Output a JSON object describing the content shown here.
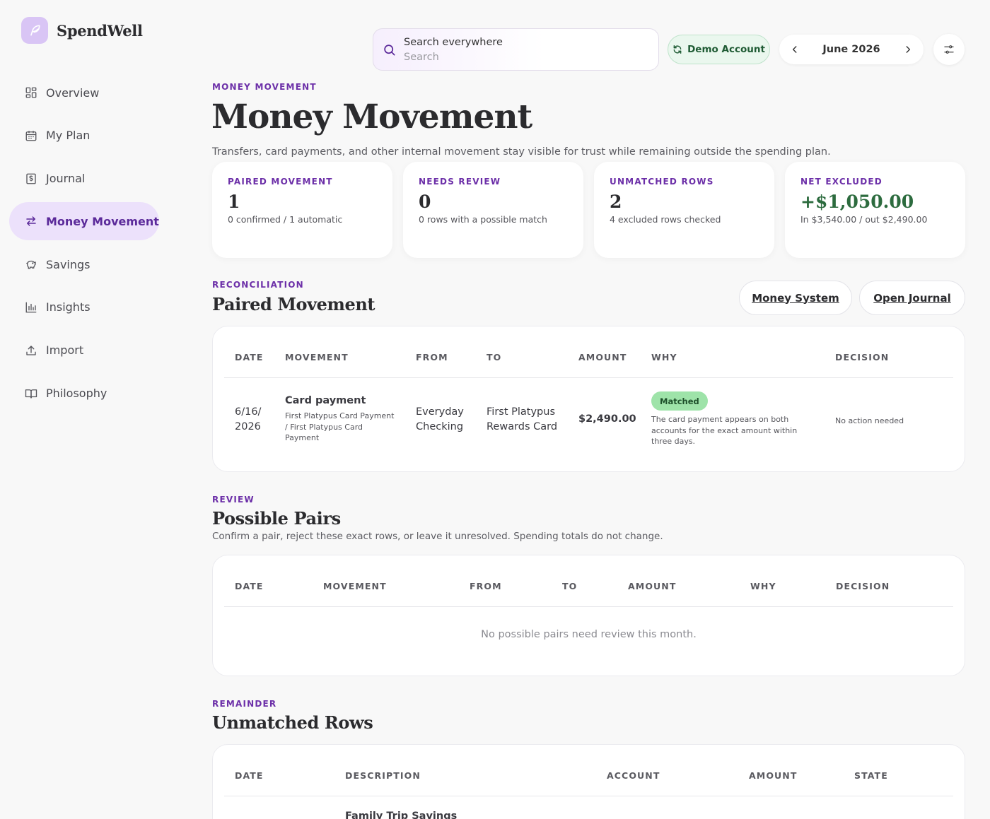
{
  "app": {
    "name": "SpendWell"
  },
  "sidebar": {
    "items": [
      {
        "label": "Overview",
        "icon": "grid-icon"
      },
      {
        "label": "My Plan",
        "icon": "calendar-icon"
      },
      {
        "label": "Journal",
        "icon": "receipt-icon"
      },
      {
        "label": "Money Movement",
        "icon": "transfer-arrows-icon",
        "active": true
      },
      {
        "label": "Savings",
        "icon": "piggy-bank-icon"
      },
      {
        "label": "Insights",
        "icon": "bar-chart-icon"
      },
      {
        "label": "Import",
        "icon": "upload-icon"
      },
      {
        "label": "Philosophy",
        "icon": "book-icon"
      }
    ]
  },
  "topbar": {
    "search_label": "Search everywhere",
    "search_placeholder": "Search",
    "demo_label": "Demo Account",
    "month": "June 2026"
  },
  "page": {
    "eyebrow": "MONEY MOVEMENT",
    "title": "Money Movement",
    "subtitle": "Transfers, card payments, and other internal movement stay visible for trust while remaining outside the spending plan."
  },
  "stats": [
    {
      "label": "PAIRED MOVEMENT",
      "value": "1",
      "note": "0 confirmed / 1 automatic"
    },
    {
      "label": "NEEDS REVIEW",
      "value": "0",
      "note": "0 rows with a possible match"
    },
    {
      "label": "UNMATCHED ROWS",
      "value": "2",
      "note": "4 excluded rows checked"
    },
    {
      "label": "NET EXCLUDED",
      "value": "+$1,050.00",
      "note": "In $3,540.00 / out $2,490.00"
    }
  ],
  "paired": {
    "eyebrow": "RECONCILIATION",
    "title": "Paired Movement",
    "money_system_label": "Money System",
    "open_journal_label": "Open Journal",
    "headers": {
      "date": "DATE",
      "movement": "MOVEMENT",
      "from": "FROM",
      "to": "TO",
      "amount": "AMOUNT",
      "why": "WHY",
      "decision": "DECISION"
    },
    "rows": [
      {
        "date_line1": "6/16/",
        "date_line2": "2026",
        "movement_title": "Card payment",
        "movement_detail": "First Platypus Card Payment / First Platypus Card Payment",
        "from_line1": "Everyday",
        "from_line2": "Checking",
        "to_line1": "First Platypus",
        "to_line2": "Rewards Card",
        "amount": "$2,490.00",
        "badge": "Matched",
        "why": "The card payment appears on both accounts for the exact amount within three days.",
        "decision": "No action needed"
      }
    ]
  },
  "review": {
    "eyebrow": "REVIEW",
    "title": "Possible Pairs",
    "subtitle": "Confirm a pair, reject these exact rows, or leave it unresolved. Spending totals do not change.",
    "headers": {
      "date": "DATE",
      "movement": "MOVEMENT",
      "from": "FROM",
      "to": "TO",
      "amount": "AMOUNT",
      "why": "WHY",
      "decision": "DECISION"
    },
    "empty": "No possible pairs need review this month."
  },
  "unmatched": {
    "eyebrow": "REMAINDER",
    "title": "Unmatched Rows",
    "headers": {
      "date": "DATE",
      "description": "DESCRIPTION",
      "account": "ACCOUNT",
      "amount": "AMOUNT",
      "state": "STATE"
    },
    "first_row_description": "Family Trip Savings"
  },
  "colors": {
    "accent": "#6c2fa8",
    "active_nav_bg": "#ece1fb",
    "positive": "#2c6b3e",
    "badge_bg": "#9ee3a9"
  }
}
